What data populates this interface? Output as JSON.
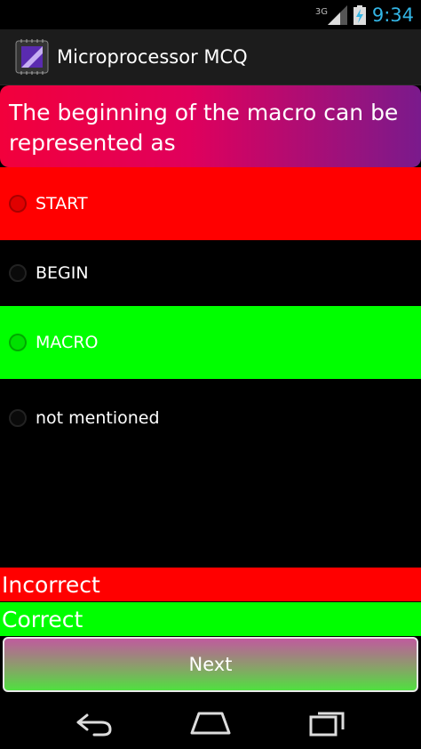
{
  "status_bar": {
    "network_type": "3G",
    "time": "9:34",
    "icons": [
      "signal-icon",
      "battery-charging-icon"
    ]
  },
  "action_bar": {
    "title": "Microprocessor MCQ",
    "icon": "app-chip-icon"
  },
  "question": {
    "text": "The beginning of the macro can be represented as"
  },
  "options": [
    {
      "label": "START",
      "state": "incorrect"
    },
    {
      "label": "BEGIN",
      "state": "none"
    },
    {
      "label": "MACRO",
      "state": "correct"
    },
    {
      "label": "not mentioned",
      "state": "none"
    }
  ],
  "results": {
    "incorrect_label": "Incorrect",
    "correct_label": "Correct"
  },
  "next_button": {
    "label": "Next"
  },
  "colors": {
    "incorrect": "#ff0000",
    "correct": "#00ff00",
    "time": "#33b5e5"
  },
  "nav_bar": {
    "icons": [
      "back-icon",
      "home-icon",
      "recent-apps-icon"
    ]
  }
}
